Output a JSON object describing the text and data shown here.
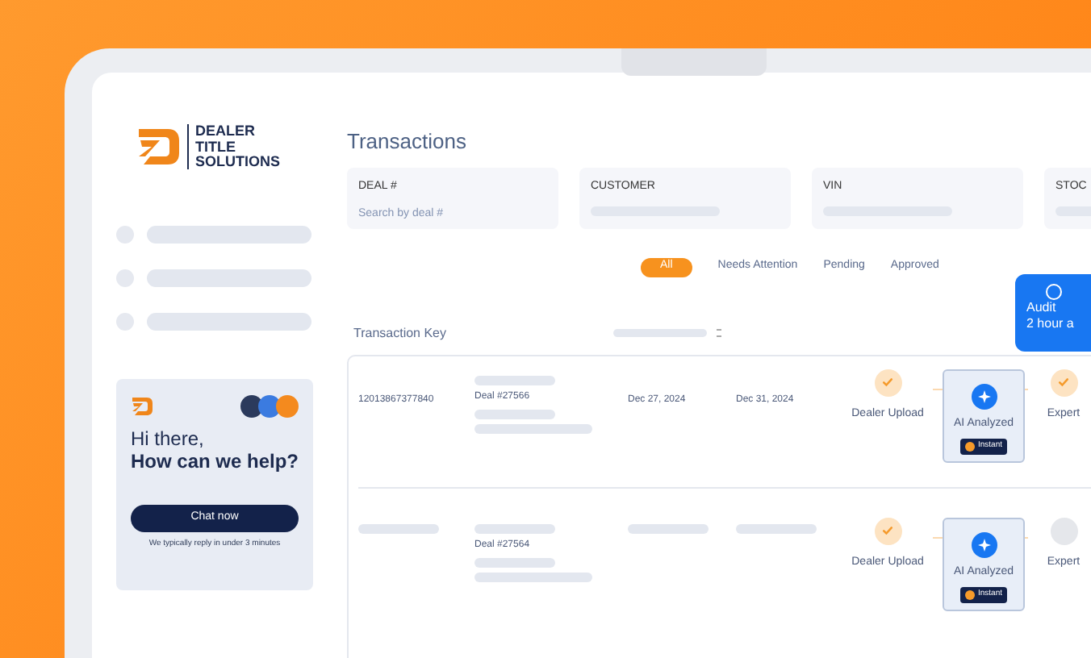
{
  "brand": {
    "lines": [
      "DEALER",
      "TITLE",
      "SOLUTIONS"
    ]
  },
  "chat_widget": {
    "greeting": "Hi there,",
    "headline": "How can we help?",
    "button": "Chat now",
    "note": "We typically reply in under 3 minutes"
  },
  "page_title": "Transactions",
  "filters": [
    {
      "label": "DEAL #",
      "placeholder": "Search by deal #"
    },
    {
      "label": "CUSTOMER"
    },
    {
      "label": "VIN"
    },
    {
      "label": "STOC"
    }
  ],
  "tabs": [
    {
      "label": "All",
      "selected": true
    },
    {
      "label": "Needs Attention",
      "selected": false
    },
    {
      "label": "Pending",
      "selected": false
    },
    {
      "label": "Approved",
      "selected": false
    }
  ],
  "table": {
    "columns": [
      "Transaction Key"
    ],
    "rows": [
      {
        "key": "12013867377840",
        "deal": "Deal #27566",
        "date_1": "Dec 27, 2024",
        "date_2": "Dec 31, 2024",
        "steps": [
          {
            "label": "Dealer Upload",
            "kind": "done"
          },
          {
            "label": "AI Analyzed",
            "kind": "ai",
            "badge": "Instant"
          },
          {
            "label": "Expert",
            "kind": "done"
          }
        ]
      },
      {
        "deal": "Deal #27564",
        "steps": [
          {
            "label": "Dealer Upload",
            "kind": "done"
          },
          {
            "label": "AI Analyzed",
            "kind": "ai",
            "badge": "Instant"
          },
          {
            "label": "Expert",
            "kind": "pending"
          }
        ]
      }
    ]
  },
  "tooltip": {
    "lines": [
      "Audit",
      "2 hour a"
    ]
  }
}
